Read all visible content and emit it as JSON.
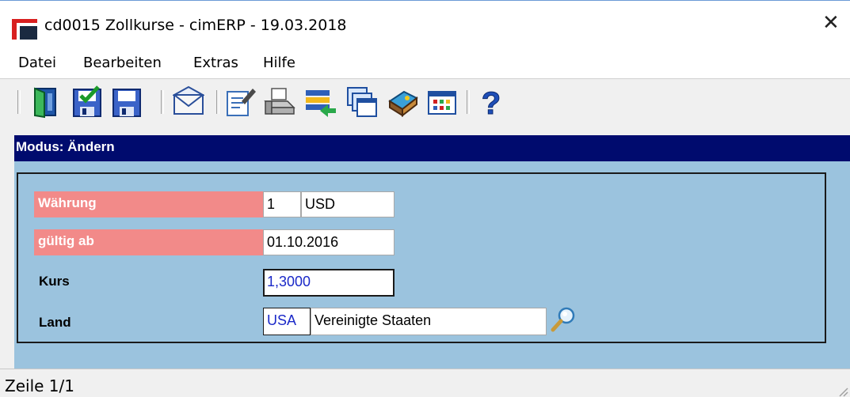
{
  "window": {
    "title": "cd0015 Zollkurse - cimERP - 19.03.2018",
    "close_glyph": "✕"
  },
  "menu": {
    "items": [
      "Datei",
      "Bearbeiten",
      "Extras",
      "Hilfe"
    ]
  },
  "toolbar": {
    "icons": [
      "exit-door-icon",
      "save-check-icon",
      "save-icon",
      "mail-icon",
      "edit-document-icon",
      "print-icon",
      "export-list-icon",
      "windows-stack-icon",
      "book-icon",
      "calendar-grid-icon",
      "help-icon"
    ]
  },
  "mode": {
    "label": "Modus: Ändern"
  },
  "form": {
    "currency": {
      "label": "Währung",
      "number": "1",
      "code": "USD"
    },
    "valid_from": {
      "label": "gültig ab",
      "value": "01.10.2016"
    },
    "rate": {
      "label": "Kurs",
      "value": "1,3000"
    },
    "country": {
      "label": "Land",
      "code": "USA",
      "name": "Vereinigte Staaten"
    }
  },
  "status": {
    "text": "Zeile 1/1"
  },
  "colors": {
    "mode_bar": "#000b6e",
    "form_background": "#9bc3de",
    "required_label": "#f28a89",
    "value_text": "#1a28c8"
  }
}
